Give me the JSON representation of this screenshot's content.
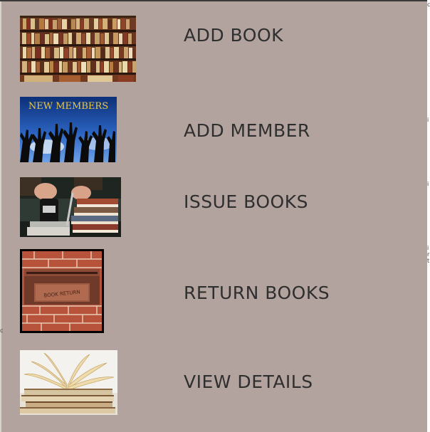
{
  "menu": {
    "items": [
      {
        "label": "ADD BOOK",
        "image": "bookshelf-image"
      },
      {
        "label": "ADD MEMBER",
        "image": "new-members-image",
        "image_caption": "NEW MEMBERS"
      },
      {
        "label": "ISSUE BOOKS",
        "image": "book-stamp-image"
      },
      {
        "label": "RETURN BOOKS",
        "image": "book-return-slot-image",
        "image_caption": "BOOK RETURN"
      },
      {
        "label": "VIEW DETAILS",
        "image": "open-book-image"
      }
    ]
  },
  "colors": {
    "panel_background": "#b3a39e",
    "label_text": "#2f2f2f"
  }
}
